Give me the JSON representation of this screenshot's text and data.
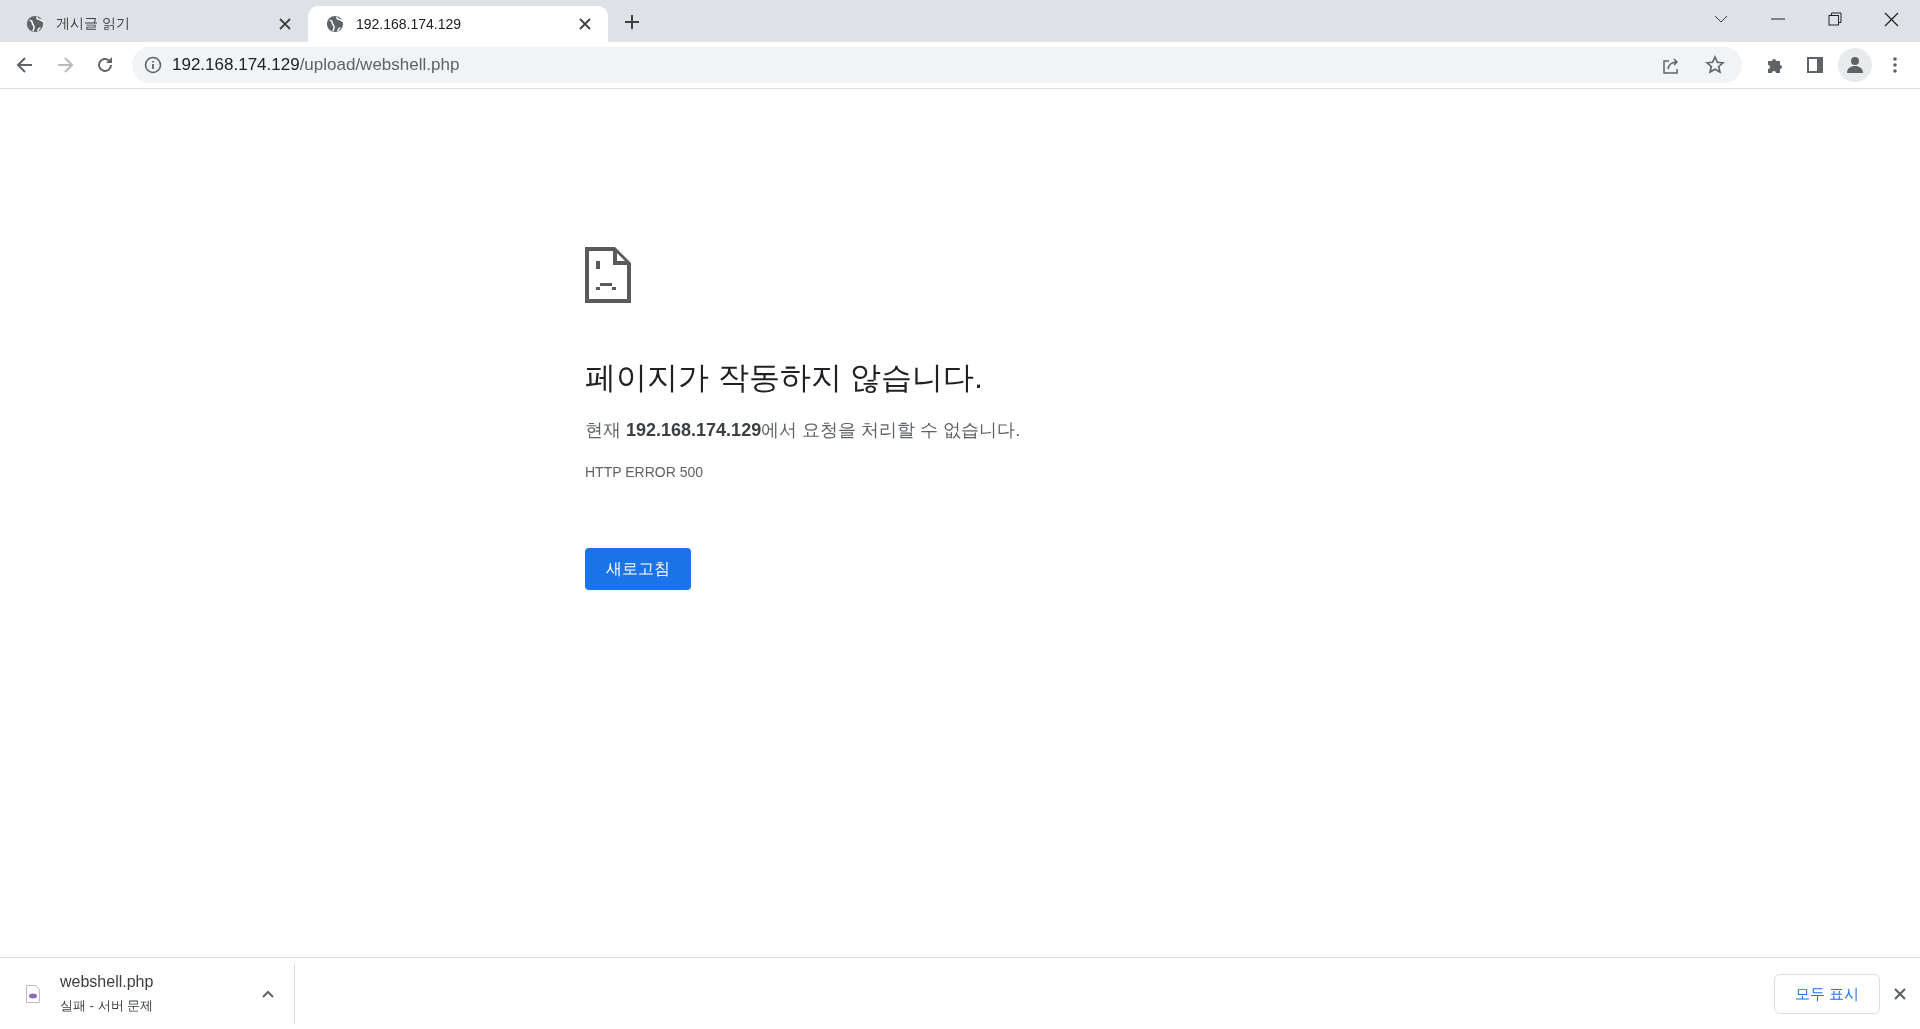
{
  "tabs": [
    {
      "title": "게시글 읽기",
      "selected": false
    },
    {
      "title": "192.168.174.129",
      "selected": true
    }
  ],
  "address_bar": {
    "host": "192.168.174.129",
    "path": "/upload/webshell.php"
  },
  "error": {
    "title": "페이지가 작동하지 않습니다.",
    "message": "현재 **192.168.174.129**에서 요청을 처리할 수 없습니다.",
    "code": "HTTP ERROR 500",
    "button": "새로고침"
  },
  "downloads": {
    "items": [
      {
        "filename": "webshell.php",
        "status": "실패 - 서버 문제"
      }
    ],
    "show_all": "모두 표시"
  }
}
